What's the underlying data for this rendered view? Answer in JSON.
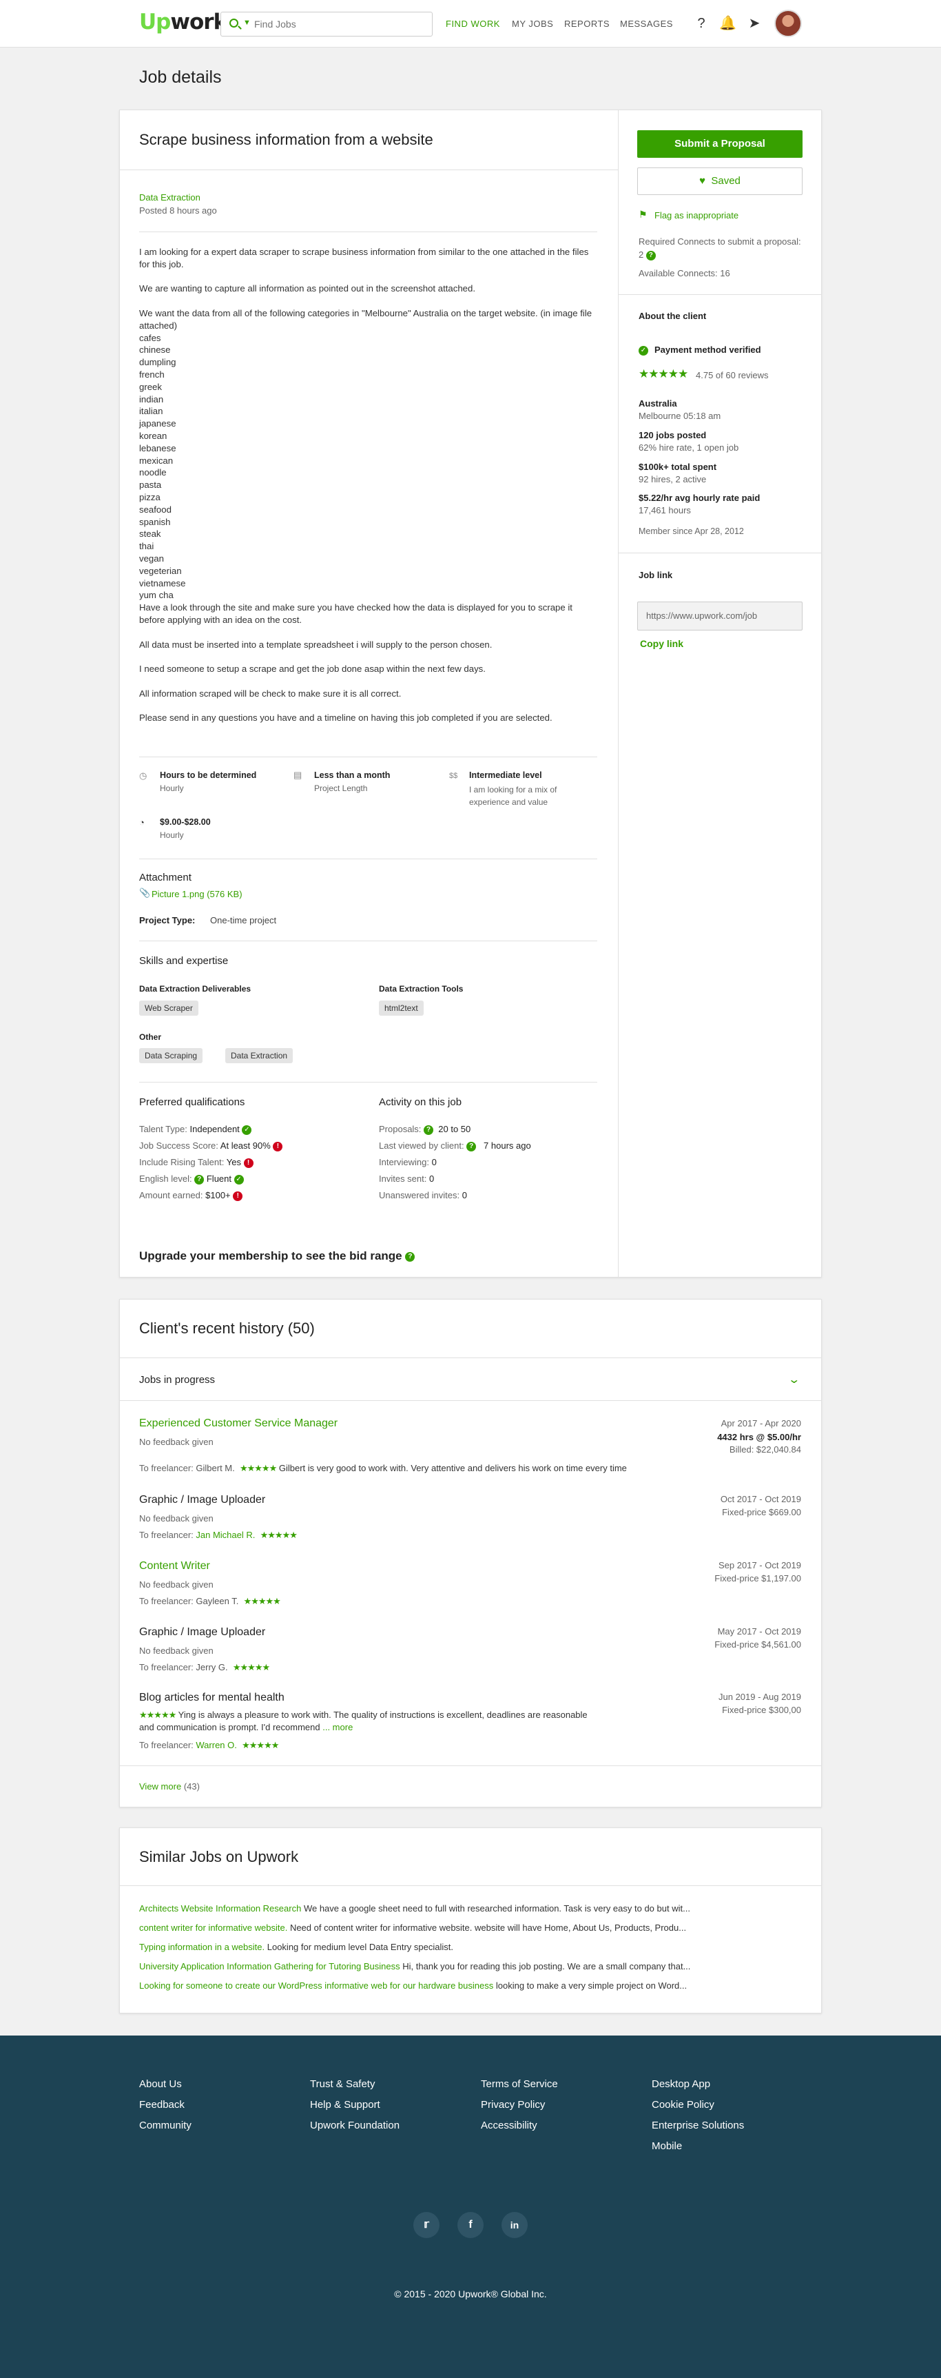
{
  "header": {
    "logo_up": "Up",
    "logo_work": "work",
    "search_placeholder": "Find Jobs",
    "nav": [
      "FIND WORK",
      "MY JOBS",
      "REPORTS",
      "MESSAGES"
    ]
  },
  "page_title": "Job details",
  "job": {
    "title": "Scrape business information from a website",
    "category": "Data Extraction",
    "posted": "Posted 8 hours ago",
    "desc_p1": "I am looking for a expert data scraper to scrape business information from similar to the one attached in the files for this job.",
    "desc_p2": "We are wanting to capture all information as pointed out in the screenshot attached.",
    "desc_p3": "We want the data from all of the following categories in \"Melbourne\" Australia on the target website. (in image file attached)",
    "categories": [
      "cafes",
      "chinese",
      "dumpling",
      "french",
      "greek",
      "indian",
      "italian",
      "japanese",
      "korean",
      "lebanese",
      "mexican",
      "noodle",
      "pasta",
      "pizza",
      "seafood",
      "spanish",
      "steak",
      "thai",
      "vegan",
      "vegeterian",
      "vietnamese",
      "yum cha"
    ],
    "desc_p4": "Have a look through the site and make sure you have checked how the data is displayed for you to scrape it before applying with an idea on the cost.",
    "desc_p5": "All data must be inserted into a template spreadsheet i will supply to the person chosen.",
    "desc_p6": "I need someone to setup a scrape and get the job done asap within the next few days.",
    "desc_p7": "All information scraped will be check to make sure it is all correct.",
    "desc_p8": "Please send in any questions you have and a timeline on having this job completed if you are selected.",
    "features": {
      "hours": {
        "title": "Hours to be determined",
        "sub": "Hourly"
      },
      "length": {
        "title": "Less than a month",
        "sub": "Project Length"
      },
      "level": {
        "title": "Intermediate level",
        "sub": "I am looking for a mix of experience and value",
        "icon": "$$"
      },
      "rate": {
        "title": "$9.00-$28.00",
        "sub": "Hourly"
      }
    },
    "attachment_label": "Attachment",
    "attachment_file": "Picture 1.png (576 KB)",
    "project_type_label": "Project Type:",
    "project_type": "One-time project",
    "skills_heading": "Skills and expertise",
    "skills": {
      "deliverables_label": "Data Extraction Deliverables",
      "deliverables": [
        "Web Scraper"
      ],
      "tools_label": "Data Extraction Tools",
      "tools": [
        "html2text"
      ],
      "other_label": "Other",
      "other": [
        "Data Scraping",
        "Data Extraction"
      ]
    },
    "prefs_heading": "Preferred qualifications",
    "prefs": [
      {
        "label": "Talent Type:",
        "value": "Independent",
        "status": "ok"
      },
      {
        "label": "Job Success Score:",
        "value": "At least 90%",
        "status": "bad"
      },
      {
        "label": "Include Rising Talent:",
        "value": "Yes",
        "status": "bad"
      },
      {
        "label": "English level:",
        "value": "Fluent",
        "status": "ok"
      },
      {
        "label": "Amount earned:",
        "value": "$100+",
        "status": "bad"
      }
    ],
    "activity_heading": "Activity on this job",
    "activity": [
      {
        "label": "Proposals:",
        "value": "20 to 50"
      },
      {
        "label": "Last viewed by client:",
        "value": "7 hours ago"
      },
      {
        "label": "Interviewing:",
        "value": "0"
      },
      {
        "label": "Invites sent:",
        "value": "0"
      },
      {
        "label": "Unanswered invites:",
        "value": "0"
      }
    ],
    "upgrade": "Upgrade your membership to see the bid range"
  },
  "sidebar": {
    "submit": "Submit a Proposal",
    "saved": "Saved",
    "flag": "Flag as inappropriate",
    "connects_req": "Required Connects to submit a proposal: 2",
    "connects_avail": "Available Connects: 16",
    "about": "About the client",
    "payment": "Payment method verified",
    "rating": "4.75 of 60 reviews",
    "country": "Australia",
    "city_time": "Melbourne 05:18 am",
    "jobs_posted": "120 jobs posted",
    "hire_rate": "62% hire rate, 1 open job",
    "spent": "$100k+ total spent",
    "hires": "92 hires, 2 active",
    "avg_rate": "$5.22/hr avg hourly rate paid",
    "hours": "17,461 hours",
    "member_since": "Member since Apr 28, 2012",
    "job_link_label": "Job link",
    "job_link": "https://www.upwork.com/job",
    "copy_link": "Copy link"
  },
  "history": {
    "title": "Client's recent history (50)",
    "in_progress": "Jobs in progress",
    "items": [
      {
        "title": "Experienced Customer Service Manager",
        "feedback": "No feedback given",
        "freelancer_prefix": "To freelancer:",
        "freelancer": "Gilbert M.",
        "comment": "Gilbert is very good to work with. Very attentive and delivers his work on time every time",
        "dates": "Apr 2017 - Apr 2020",
        "price1": "4432 hrs @ $5.00/hr",
        "price2": "Billed: $22,040.84"
      },
      {
        "title": "Graphic / Image Uploader",
        "feedback": "No feedback given",
        "freelancer_prefix": "To freelancer:",
        "freelancer": "Jan Michael R.",
        "dates": "Oct 2017 - Oct 2019",
        "price1": "Fixed-price $669.00"
      },
      {
        "title": "Content Writer",
        "feedback": "No feedback given",
        "freelancer_prefix": "To freelancer:",
        "freelancer": "Gayleen T.",
        "dates": "Sep 2017 - Oct 2019",
        "price1": "Fixed-price $1,197.00"
      },
      {
        "title": "Graphic / Image Uploader",
        "feedback": "No feedback given",
        "freelancer_prefix": "To freelancer:",
        "freelancer": "Jerry G.",
        "dates": "May 2017 - Oct 2019",
        "price1": "Fixed-price $4,561.00"
      },
      {
        "title": "Blog articles for mental health",
        "comment": "Ying is always a pleasure to work with. The quality of instructions is excellent, deadlines are reasonable",
        "comment2": "and communication is prompt. I'd recommend",
        "more": "... more",
        "freelancer_prefix": "To freelancer:",
        "freelancer": "Warren O.",
        "dates": "Jun 2019 - Aug 2019",
        "price1": "Fixed-price $300,00"
      }
    ],
    "view_more": "View more",
    "view_more_count": "(43)"
  },
  "similar": {
    "title": "Similar Jobs on Upwork",
    "items": [
      {
        "title": "Architects Website Information Research",
        "text": "We have a google sheet need to full with researched information. Task is very easy to do but wit..."
      },
      {
        "title": "content writer for informative website.",
        "text": "Need of content writer for informative website. website will have Home, About Us, Products, Produ..."
      },
      {
        "title": "Typing information in a website.",
        "text": "Looking for medium level Data Entry specialist."
      },
      {
        "title": "University Application Information Gathering for Tutoring Business",
        "text": "Hi, thank you for reading this job posting. We are a small company that..."
      },
      {
        "title": "Looking for someone to create our WordPress informative web for our hardware business",
        "text": "looking to make a very simple project on Word..."
      }
    ]
  },
  "footer": {
    "col1": [
      "About Us",
      "Feedback",
      "Community"
    ],
    "col2": [
      "Trust & Safety",
      "Help & Support",
      "Upwork Foundation"
    ],
    "col3": [
      "Terms of Service",
      "Privacy Policy",
      "Accessibility"
    ],
    "col4": [
      "Desktop App",
      "Cookie Policy",
      "Enterprise Solutions",
      "Mobile"
    ],
    "copyright": "© 2015 - 2020 Upwork® Global Inc."
  },
  "colors": {
    "brand": "#37a000",
    "footer": "#1d4354",
    "error": "#d0021b"
  }
}
